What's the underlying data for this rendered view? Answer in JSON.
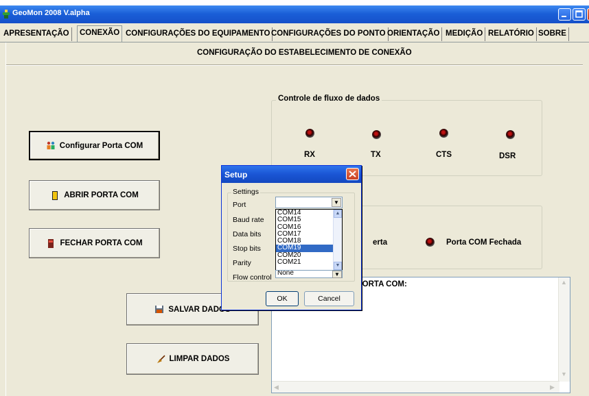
{
  "window": {
    "title": "GeoMon 2008 V.alpha"
  },
  "tabs": [
    {
      "label": "APRESENTAÇÃO"
    },
    {
      "label": "CONEXÃO"
    },
    {
      "label": "CONFIGURAÇÕES DO EQUIPAMENTO"
    },
    {
      "label": "CONFIGURAÇÕES DO PONTO"
    },
    {
      "label": "ORIENTAÇÃO"
    },
    {
      "label": "MEDIÇÃO"
    },
    {
      "label": "RELATÓRIO"
    },
    {
      "label": "SOBRE"
    }
  ],
  "active_tab": "CONEXÃO",
  "main": {
    "section_title": "CONFIGURAÇÃO DO ESTABELECIMENTO DE CONEXÃO",
    "buttons": {
      "configurar": "Configurar Porta COM",
      "abrir": "ABRIR PORTA COM",
      "fechar": "FECHAR PORTA COM",
      "salvar": "SALVAR DADOS",
      "limpar": "LIMPAR DADOS"
    },
    "flow": {
      "title": "Controle de fluxo de dados",
      "leds": [
        "RX",
        "TX",
        "CTS",
        "DSR"
      ]
    },
    "status": {
      "open_label_partial": "erta",
      "closed_label": "Porta COM Fechada"
    },
    "log_title_partial": "PORTA COM:"
  },
  "dialog": {
    "title": "Setup",
    "group_label": "Settings",
    "labels": {
      "port": "Port",
      "baud": "Baud rate",
      "data": "Data bits",
      "stop": "Stop bits",
      "parity": "Parity",
      "flow": "Flow control"
    },
    "port_value": "",
    "port_options": [
      "COM14",
      "COM15",
      "COM16",
      "COM17",
      "COM18",
      "COM19",
      "COM20",
      "COM21"
    ],
    "selected_port": "COM19",
    "flow_value": "None",
    "ok": "OK",
    "cancel": "Cancel"
  },
  "colors": {
    "titlebar": "#1a5fd8",
    "selection": "#316ac5",
    "face": "#ece9d8"
  }
}
